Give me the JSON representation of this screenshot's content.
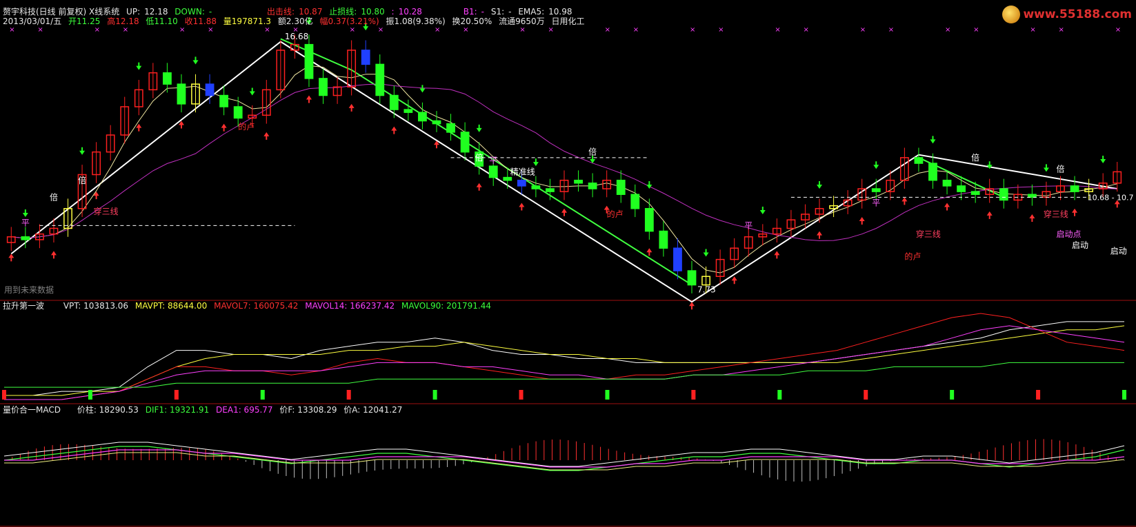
{
  "header": {
    "title": "赘宇科技(日线 前复权) X线系统",
    "up_label": "UP:",
    "up_value": "12.18",
    "down_label": "DOWN:",
    "down_value": "-",
    "exit_label": "出击线:",
    "exit_value": "10.87",
    "stop_label": "止损线:",
    "stop_value": "10.80",
    "mid_label": ":",
    "mid_value": "10.28",
    "b1_label": "B1:",
    "b1_value": "-",
    "s1_label": "S1:",
    "s1_value": "-",
    "ema_label": "EMA5:",
    "ema_value": "10.98"
  },
  "quote": {
    "date": "2013/03/01/五",
    "open": "开11.25",
    "high": "高12.18",
    "low": "低11.10",
    "close": "收11.88",
    "volume": "量197871.3",
    "amount": "额2.30亿",
    "change": "幅0.37(3.21%)",
    "amplitude": "振1.08(9.38%)",
    "turnover": "换20.50%",
    "float": "流通9650万",
    "sector": "日用化工"
  },
  "logo": "www.55188.com",
  "price_labels": {
    "high": "16.68",
    "low": "7.73",
    "right": "10.68 - 10.7",
    "future": "用到未来数据",
    "bei": "倍",
    "ping": "平",
    "chuan": "穿三线",
    "qi": "启动点",
    "qidong": "启动",
    "di": "的卢",
    "zhun": "精准线",
    "tuo": "托"
  },
  "panel2": {
    "name": "拉升第一波",
    "vpt": "VPT: 103813.06",
    "mavpt": "MAVPT: 88644.00",
    "mavol7": "MAVOL7: 160075.42",
    "mavol14": "MAVOL14: 166237.42",
    "mavol90": "MAVOL90: 201791.44"
  },
  "panel3": {
    "name": "量价合一MACD",
    "zhu": "价柱: 18290.53",
    "dif": "DIF1: 19321.91",
    "dea": "DEA1: 695.77",
    "f": "价F: 13308.29",
    "a": "价A: 12041.27"
  },
  "colors": {
    "up": "#ff2020",
    "down": "#20ff20",
    "white": "#ffffff",
    "green_line": "#40ff40",
    "magenta": "#ff40ff",
    "yellow": "#ffff40",
    "blue": "#2040ff"
  },
  "chart_data": [
    {
      "type": "line",
      "title": "赘宇科技(日线 前复权) X线系统",
      "note_series": [
        {
          "name": "收盘价",
          "values": [
            9.6,
            9.5,
            9.7,
            9.9,
            10.6,
            11.8,
            12.6,
            13.2,
            14.2,
            14.8,
            15.4,
            15.0,
            14.3,
            15.0,
            14.6,
            14.2,
            13.8,
            13.9,
            14.8,
            16.2,
            16.4,
            15.2,
            14.6,
            14.9,
            16.2,
            15.7,
            14.6,
            14.1,
            14.0,
            13.7,
            13.6,
            13.3,
            12.6,
            12.1,
            11.7,
            11.6,
            11.4,
            11.3,
            11.2,
            11.6,
            11.5,
            11.3,
            11.6,
            11.1,
            10.6,
            9.8,
            9.2,
            8.4,
            7.9,
            8.2,
            8.8,
            9.2,
            9.6,
            9.7,
            9.9,
            10.2,
            10.4,
            10.6,
            10.7,
            10.9,
            11.3,
            11.2,
            11.6,
            12.4,
            12.2,
            11.6,
            11.4,
            11.2,
            11.1,
            11.3,
            10.9,
            11.1,
            11.0,
            11.2,
            11.4,
            11.2,
            11.3,
            11.5,
            11.9
          ]
        }
      ],
      "ylim": [
        7.5,
        17.0
      ],
      "markers": {
        "max": 16.68,
        "min": 7.73
      }
    },
    {
      "type": "line",
      "title": "拉升第一波",
      "series": [
        {
          "name": "VPT",
          "values": [
            2,
            2,
            3,
            3,
            4,
            9,
            13,
            13,
            12,
            12,
            11,
            13,
            14,
            15,
            15,
            16,
            15,
            13,
            12,
            12,
            11,
            11,
            10,
            10,
            10,
            10,
            10,
            10,
            10,
            11,
            12,
            13,
            14,
            15,
            16,
            18,
            19,
            20,
            20,
            20
          ]
        },
        {
          "name": "MAVPT",
          "values": [
            2,
            2,
            2,
            3,
            3,
            6,
            9,
            11,
            12,
            12,
            12,
            12,
            13,
            13,
            14,
            14,
            15,
            14,
            13,
            12,
            12,
            11,
            11,
            10,
            10,
            10,
            10,
            10,
            10,
            10,
            11,
            12,
            13,
            14,
            15,
            16,
            17,
            18,
            18,
            19
          ]
        },
        {
          "name": "MAVOL7",
          "values": [
            1,
            1,
            1,
            2,
            3,
            6,
            9,
            9,
            8,
            8,
            7,
            8,
            10,
            11,
            10,
            10,
            9,
            8,
            7,
            6,
            6,
            6,
            7,
            7,
            8,
            9,
            10,
            11,
            12,
            13,
            15,
            17,
            19,
            21,
            22,
            21,
            18,
            15,
            14,
            13
          ]
        },
        {
          "name": "MAVOL14",
          "values": [
            1,
            1,
            1,
            2,
            3,
            5,
            7,
            8,
            8,
            8,
            8,
            8,
            9,
            10,
            10,
            10,
            9,
            9,
            8,
            7,
            7,
            6,
            6,
            6,
            7,
            7,
            8,
            9,
            10,
            11,
            12,
            13,
            14,
            16,
            18,
            19,
            18,
            17,
            16,
            15
          ]
        },
        {
          "name": "MAVOL90",
          "values": [
            4,
            4,
            4,
            4,
            4,
            4,
            5,
            5,
            5,
            5,
            5,
            5,
            5,
            6,
            6,
            6,
            6,
            6,
            6,
            6,
            6,
            6,
            6,
            6,
            7,
            7,
            7,
            7,
            8,
            8,
            8,
            9,
            9,
            9,
            9,
            10,
            10,
            10,
            10,
            10
          ]
        }
      ]
    },
    {
      "type": "line",
      "title": "量价合一MACD",
      "series": [
        {
          "name": "DIF1",
          "values": [
            0,
            1,
            2,
            3,
            4,
            4,
            3,
            2,
            1,
            0,
            -1,
            0,
            1,
            2,
            2,
            1,
            0,
            -1,
            -2,
            -3,
            -3,
            -2,
            -1,
            0,
            1,
            1,
            2,
            2,
            1,
            0,
            -1,
            -1,
            0,
            0,
            -1,
            -2,
            -1,
            0,
            1,
            3
          ]
        },
        {
          "name": "DEA1",
          "values": [
            0,
            0,
            1,
            2,
            3,
            3,
            3,
            2,
            2,
            1,
            0,
            0,
            0,
            1,
            1,
            1,
            1,
            0,
            -1,
            -2,
            -2,
            -2,
            -1,
            -1,
            0,
            0,
            1,
            1,
            1,
            1,
            0,
            0,
            0,
            0,
            -1,
            -1,
            -1,
            0,
            0,
            1
          ]
        }
      ]
    }
  ]
}
